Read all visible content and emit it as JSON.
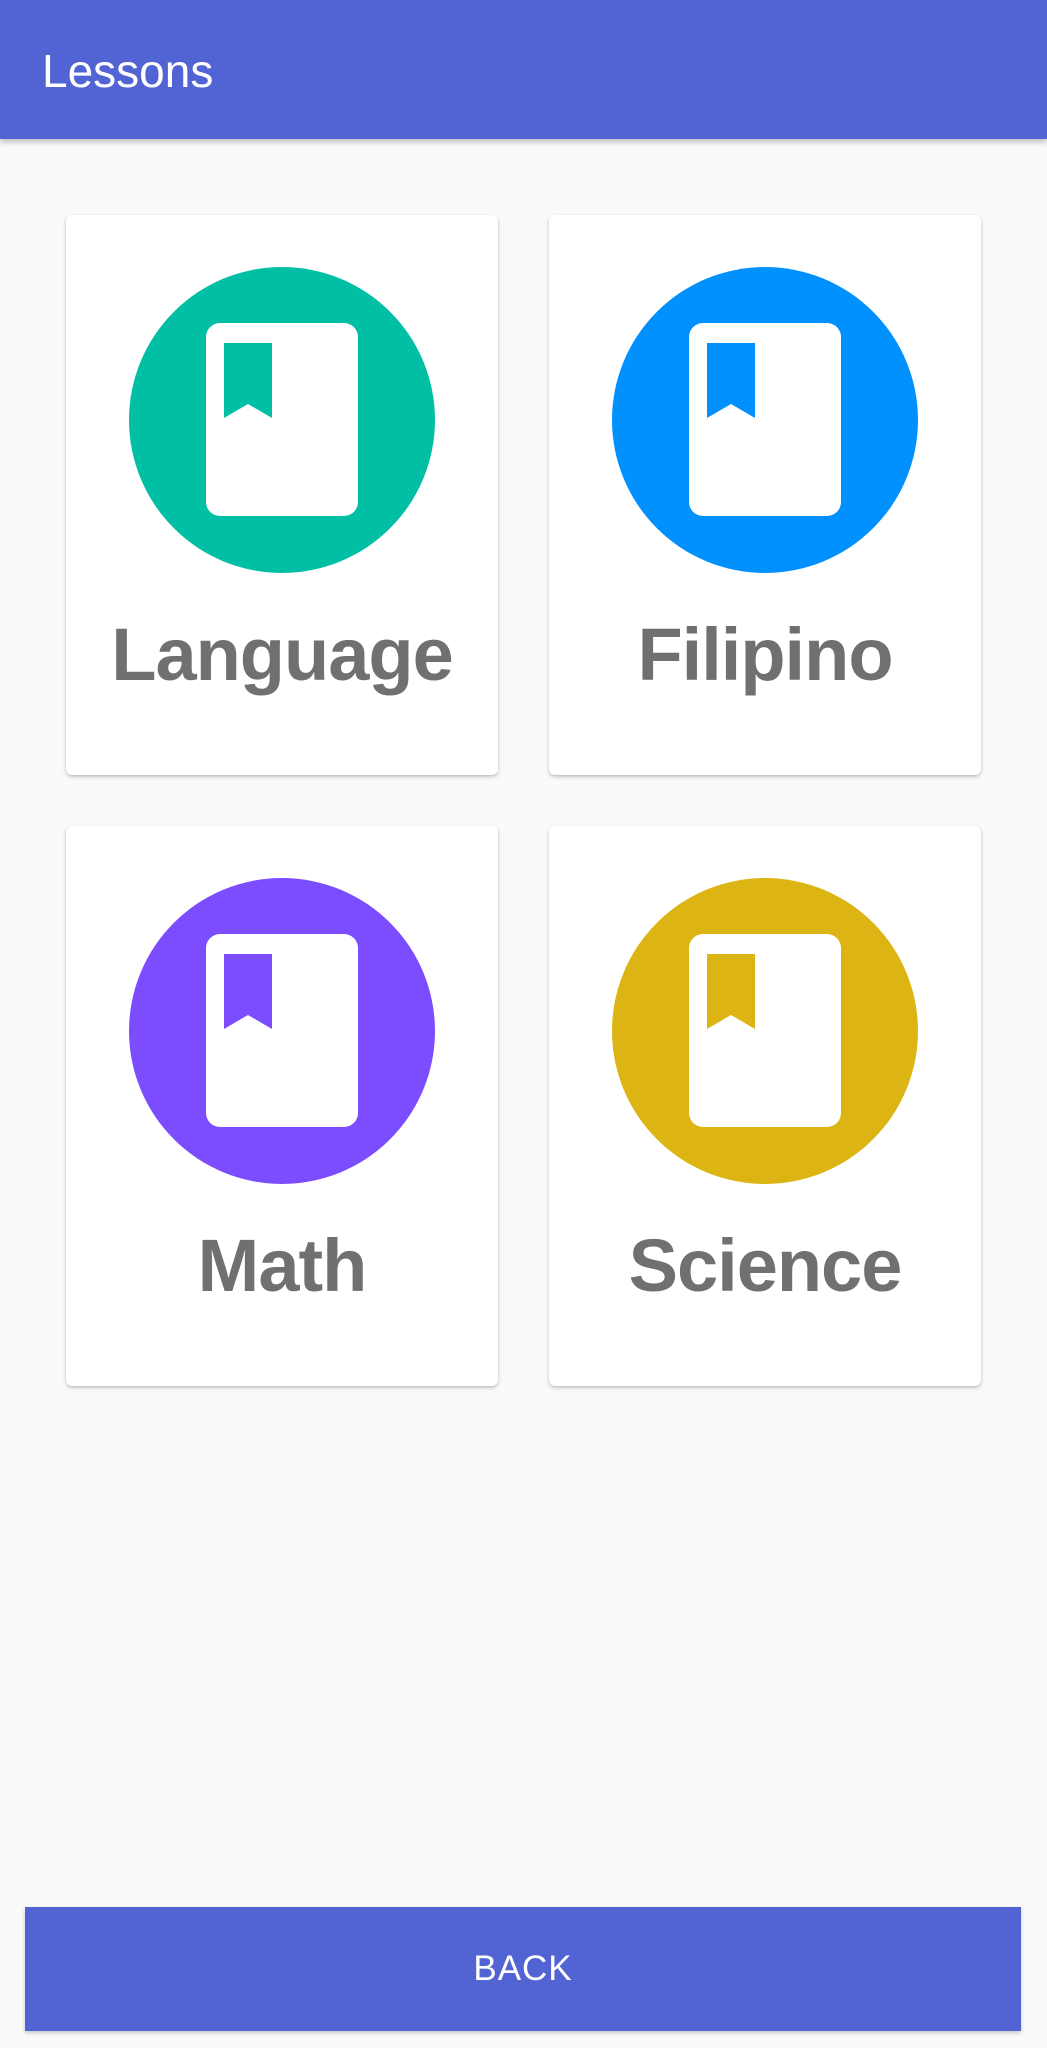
{
  "app_bar": {
    "title": "Lessons"
  },
  "lessons": [
    {
      "label": "Language",
      "icon": "book-icon",
      "color": "#00bfa5"
    },
    {
      "label": "Filipino",
      "icon": "book-icon",
      "color": "#0091ff"
    },
    {
      "label": "Math",
      "icon": "book-icon",
      "color": "#7c4dff"
    },
    {
      "label": "Science",
      "icon": "book-icon",
      "color": "#dcb514"
    }
  ],
  "footer": {
    "back_label": "BACK"
  },
  "colors": {
    "primary": "#5264d4",
    "label_text": "#707070",
    "background": "#fafafa"
  }
}
